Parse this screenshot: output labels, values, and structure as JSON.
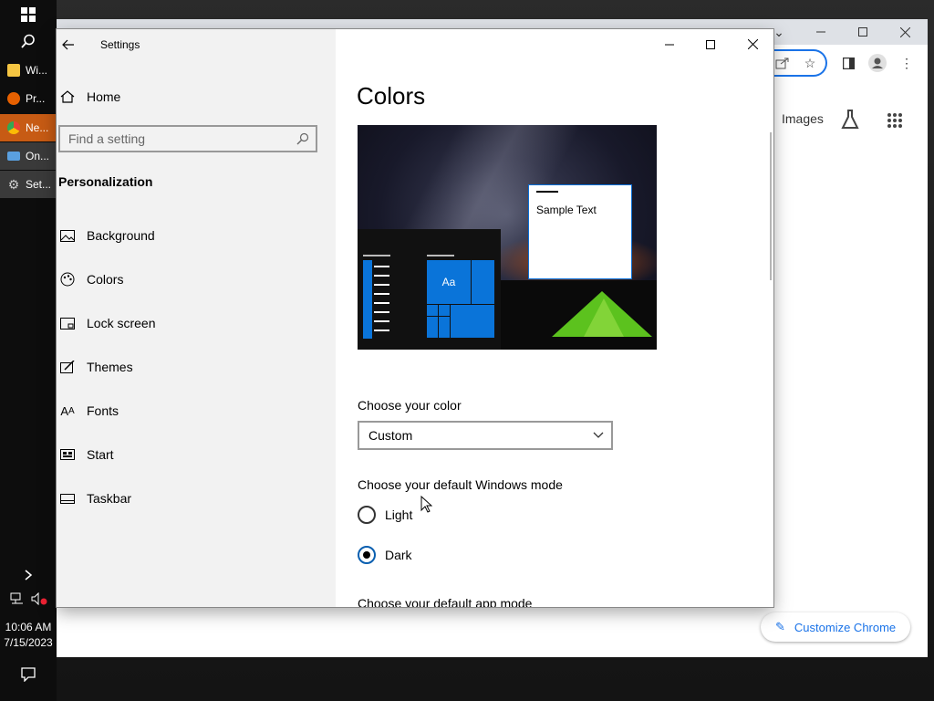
{
  "taskbar": {
    "items": [
      {
        "label": "Wi...",
        "color": "#f5c542"
      },
      {
        "label": "Pr...",
        "color": "#e66000"
      },
      {
        "label": "Ne...",
        "color": "#34a853"
      },
      {
        "label": "On...",
        "color": "#5aa0e0"
      },
      {
        "label": "Set...",
        "color": "#cccccc"
      }
    ],
    "time": "10:06 AM",
    "date": "7/15/2023"
  },
  "chrome": {
    "images_link": "Images",
    "customize_label": "Customize Chrome"
  },
  "settings": {
    "window_title": "Settings",
    "nav": {
      "home": "Home",
      "search_placeholder": "Find a setting",
      "section": "Personalization",
      "items": [
        {
          "label": "Background"
        },
        {
          "label": "Colors"
        },
        {
          "label": "Lock screen"
        },
        {
          "label": "Themes"
        },
        {
          "label": "Fonts"
        },
        {
          "label": "Start"
        },
        {
          "label": "Taskbar"
        }
      ]
    },
    "content": {
      "title": "Colors",
      "preview": {
        "sample_text": "Sample Text",
        "tile_text": "Aa"
      },
      "choose_color_label": "Choose your color",
      "choose_color_value": "Custom",
      "windows_mode_label": "Choose your default Windows mode",
      "windows_mode_options": [
        {
          "label": "Light",
          "selected": false
        },
        {
          "label": "Dark",
          "selected": true
        }
      ],
      "app_mode_label": "Choose your default app mode"
    }
  },
  "colors": {
    "accent": "#0a74d9",
    "taskbar": "#0d0d0d",
    "nav_bg": "#f2f2f2"
  }
}
